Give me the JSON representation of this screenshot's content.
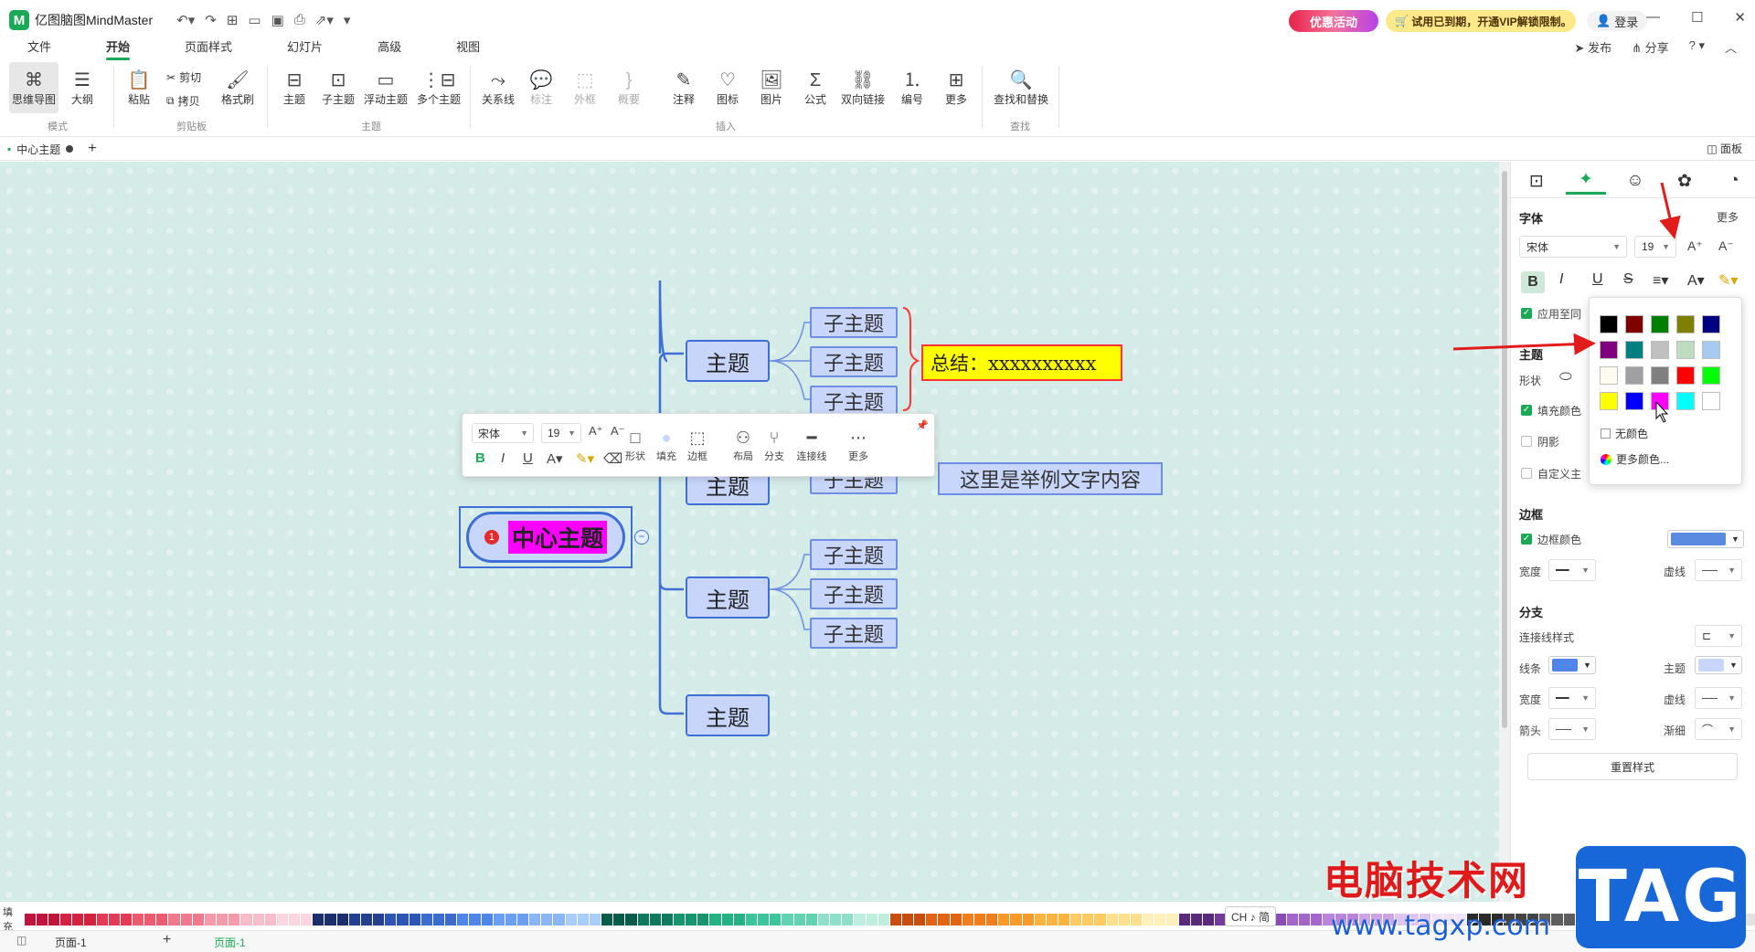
{
  "app": {
    "title": "亿图脑图MindMaster",
    "logo_letter": "M",
    "promo": "优惠活动",
    "vip_notice": "试用已到期，开通VIP解锁限制。",
    "login": "登录",
    "publish": "发布",
    "share": "分享"
  },
  "menu": [
    "文件",
    "开始",
    "页面样式",
    "幻灯片",
    "高级",
    "视图"
  ],
  "ribbon": {
    "mode": {
      "mindmap": "思维导图",
      "outline": "大纲",
      "group": "模式"
    },
    "clipboard": {
      "paste": "粘贴",
      "cut": "剪切",
      "copy": "拷贝",
      "format_painter": "格式刷",
      "group": "剪贴板"
    },
    "topic": {
      "topic": "主题",
      "subtopic": "子主题",
      "floating": "浮动主题",
      "multiple": "多个主题",
      "group": "主题"
    },
    "insert": {
      "relation": "关系线",
      "callout": "标注",
      "boundary": "外框",
      "summary": "概要",
      "note": "注释",
      "icon": "图标",
      "picture": "图片",
      "formula": "公式",
      "bilink": "双向链接",
      "numbering": "编号",
      "more": "更多",
      "group": "插入"
    },
    "find": {
      "find_replace": "查找和替换",
      "group": "查找"
    }
  },
  "doc": {
    "tab": "中心主题",
    "panel_toggle": "面板"
  },
  "mindmap": {
    "central": "中心主题",
    "central_badge": "1",
    "main_topics": [
      "主题",
      "主题",
      "主题",
      "主题"
    ],
    "subtopics_a": [
      "子主题",
      "子主题",
      "子主题"
    ],
    "subtopic_b": "子主题",
    "subtopics_c": [
      "子主题",
      "子主题",
      "子主题"
    ],
    "summary": "总结：xxxxxxxxxx",
    "floating_text": "这里是举例文字内容"
  },
  "mini_toolbar": {
    "font": "宋体",
    "size": "19",
    "shape": "形状",
    "fill": "填充",
    "border": "边框",
    "layout": "布局",
    "branch": "分支",
    "connector": "连接线",
    "more": "更多"
  },
  "panel": {
    "font_section": "字体",
    "more": "更多",
    "font_name": "宋体",
    "font_size": "19",
    "apply_all": "应用至同",
    "topic_section": "主题",
    "shape": "形状",
    "fill_color": "填充颜色",
    "shadow": "阴影",
    "custom": "自定义主",
    "border_section": "边框",
    "border_color": "边框颜色",
    "width": "宽度",
    "dash": "虚线",
    "branch_section": "分支",
    "connector_style": "连接线样式",
    "line": "线条",
    "topic": "主题",
    "width2": "宽度",
    "dash2": "虚线",
    "arrow": "箭头",
    "taper": "渐细",
    "reset": "重置样式"
  },
  "color_popup": {
    "colors": [
      "#000000",
      "#800000",
      "#008000",
      "#808000",
      "#000080",
      "#800080",
      "#008080",
      "#c0c0c0",
      "#c0dcc0",
      "#a6caf0",
      "#fffbf0",
      "#a0a0a4",
      "#808080",
      "#ff0000",
      "#00ff00",
      "#ffff00",
      "#0000ff",
      "#ff00ff",
      "#00ffff",
      "#ffffff"
    ],
    "no_color": "无颜色",
    "more_colors": "更多颜色..."
  },
  "status": {
    "fill_label": "填充",
    "page": "页面-1",
    "page_tab": "页面-1",
    "ime": "CH ♪ 简"
  },
  "watermark": {
    "text": "电脑技术网",
    "url": "www.tagxp.com",
    "tag": "TAG"
  }
}
